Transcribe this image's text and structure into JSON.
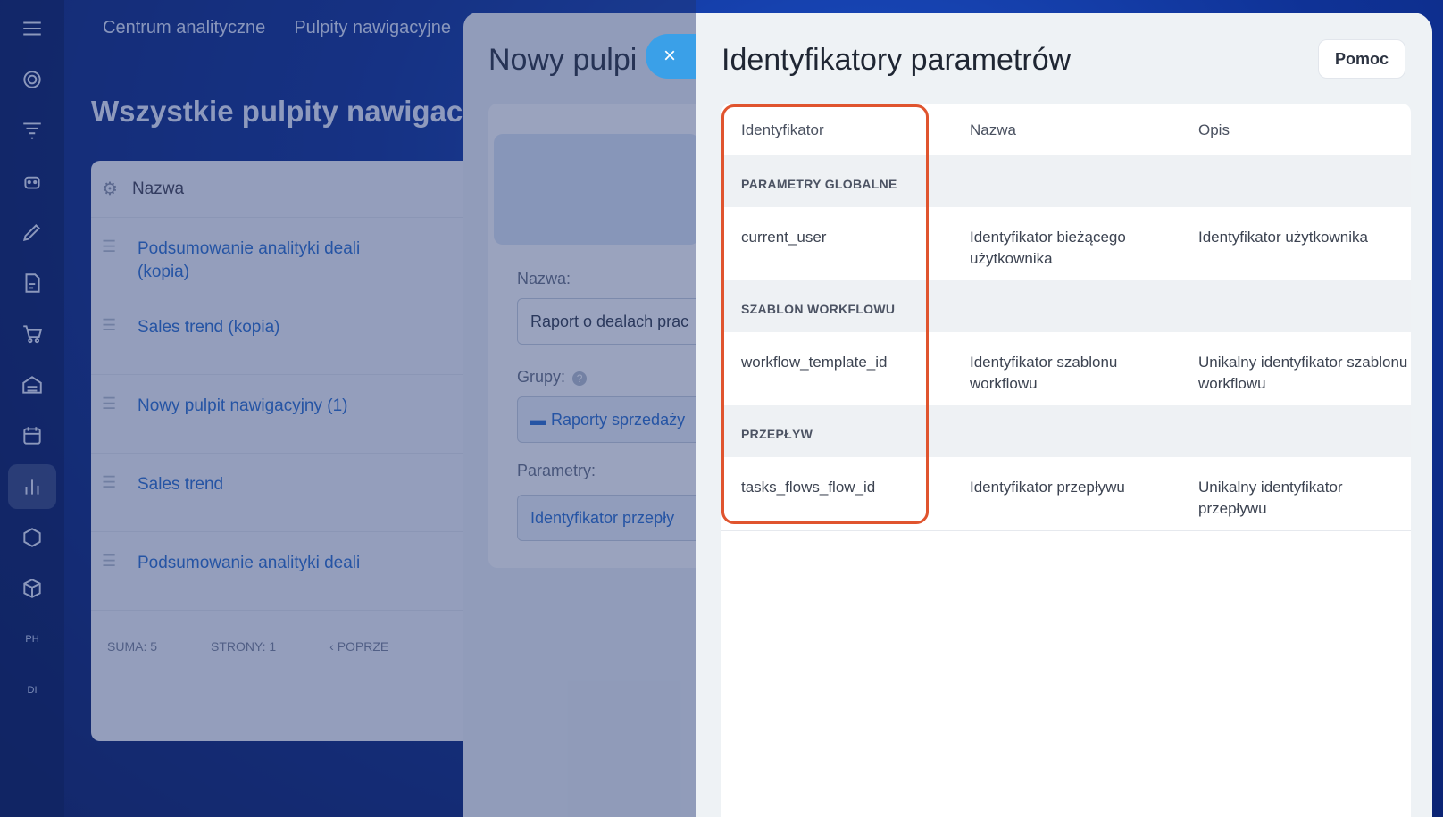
{
  "background": {
    "topnav": [
      "Centrum analityczne",
      "Pulpity nawigacyjne"
    ],
    "title": "Wszystkie pulpity nawigacyjne",
    "list_header": "Nazwa",
    "rows": [
      "Podsumowanie analityki deali (kopia)",
      "Sales trend (kopia)",
      "Nowy pulpit nawigacyjny (1)",
      "Sales trend",
      "Podsumowanie analityki deali"
    ],
    "footer": {
      "total": "SUMA: 5",
      "pages": "STRONY:  1",
      "prev": "‹ POPRZE"
    },
    "rail_badges": [
      "PH",
      "DI"
    ]
  },
  "middle_panel": {
    "title": "Nowy pulpi",
    "name_label": "Nazwa:",
    "name_value": "Raport o dealach prac",
    "groups_label": "Grupy:",
    "groups_value": "Raporty sprzedaży",
    "params_label": "Parametry:",
    "params_value": "Identyfikator przepły"
  },
  "close_button": "×",
  "panel": {
    "title": "Identyfikatory parametrów",
    "help_button": "Pomoc",
    "columns": [
      "Identyfikator",
      "Nazwa",
      "Opis"
    ],
    "groups": [
      {
        "label": "PARAMETRY GLOBALNE",
        "rows": [
          {
            "id": "current_user",
            "name": "Identyfikator bieżącego użytkownika",
            "desc": "Identyfikator użytkownika"
          }
        ]
      },
      {
        "label": "SZABLON WORKFLOWU",
        "rows": [
          {
            "id": "workflow_template_id",
            "name": "Identyfikator szablonu workflowu",
            "desc": "Unikalny identyfikator szablonu workflowu"
          }
        ]
      },
      {
        "label": "PRZEPŁYW",
        "rows": [
          {
            "id": "tasks_flows_flow_id",
            "name": "Identyfikator przepływu",
            "desc": "Unikalny identyfikator przepływu"
          }
        ]
      }
    ]
  },
  "colors": {
    "highlight": "#e0542e",
    "accent": "#3aa0e8",
    "link": "#2b6fcf"
  }
}
